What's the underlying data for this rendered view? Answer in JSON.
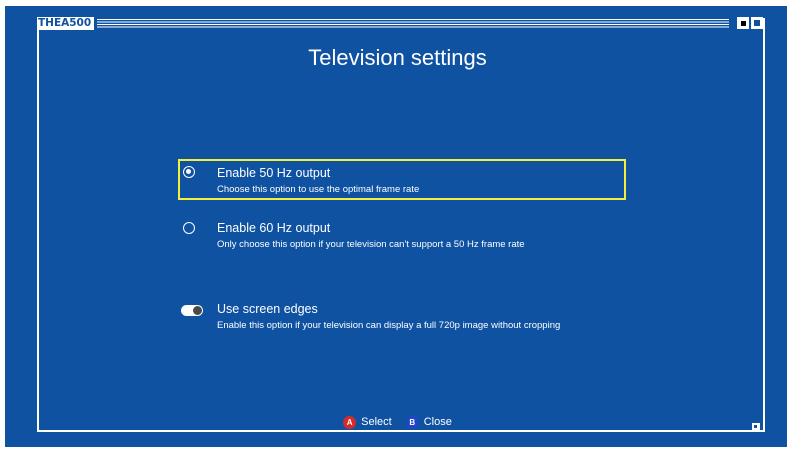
{
  "window": {
    "title": "THEA500"
  },
  "page": {
    "title": "Television settings"
  },
  "options": [
    {
      "label": "Enable 50 Hz output",
      "description": "Choose this option to use the optimal frame rate",
      "type": "radio",
      "checked": true,
      "focused": true
    },
    {
      "label": "Enable 60 Hz output",
      "description": "Only choose this option if your television can't support a 50 Hz frame rate",
      "type": "radio",
      "checked": false,
      "focused": false
    },
    {
      "label": "Use screen edges",
      "description": "Enable this option if your television can display a full 720p image without cropping",
      "type": "toggle",
      "checked": true,
      "focused": false
    }
  ],
  "footer": {
    "select_glyph": "A",
    "select_label": "Select",
    "close_glyph": "B",
    "close_label": "Close"
  },
  "colors": {
    "background": "#0f52a2",
    "focus_border": "#f3ef3a",
    "button_a": "#d52a2a",
    "button_b": "#2245c4"
  },
  "icons": {
    "resize": "resize-handle-icon"
  }
}
